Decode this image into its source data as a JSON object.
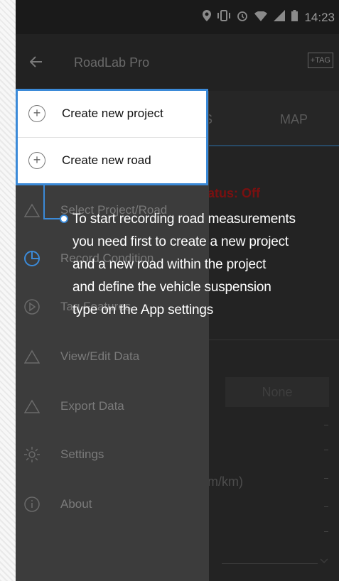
{
  "status_bar": {
    "time": "14:23"
  },
  "app_bar": {
    "title": "RoadLab Pro",
    "tag_button": "+TAG"
  },
  "tabs": {
    "stats_partial": "S",
    "map": "MAP"
  },
  "content": {
    "status_text": "atus: Off",
    "none_button": "None",
    "iri_label": "m/km)"
  },
  "highlight": {
    "items": [
      {
        "label": "Create new project",
        "icon": "plus-circle-icon"
      },
      {
        "label": "Create new road",
        "icon": "plus-circle-icon"
      }
    ]
  },
  "drawer": {
    "items": [
      {
        "label": "Select Project/Road",
        "icon": "mountain-icon"
      },
      {
        "label": "Record Condition",
        "icon": "clock-icon"
      },
      {
        "label": "Tag Features",
        "icon": "play-circle-icon"
      },
      {
        "label": "View/Edit Data",
        "icon": "mountain-icon"
      },
      {
        "label": "Export Data",
        "icon": "mountain-icon"
      },
      {
        "label": "Settings",
        "icon": "gear-icon"
      },
      {
        "label": "About",
        "icon": "info-icon"
      }
    ]
  },
  "callout": {
    "text": "To start recording road measurements\nyou need first to create a new project\nand a new road within the project\nand define the vehicle suspension\ntype on the App settings"
  },
  "colors": {
    "accent": "#3b8ad8",
    "status_off": "#7a1010"
  }
}
